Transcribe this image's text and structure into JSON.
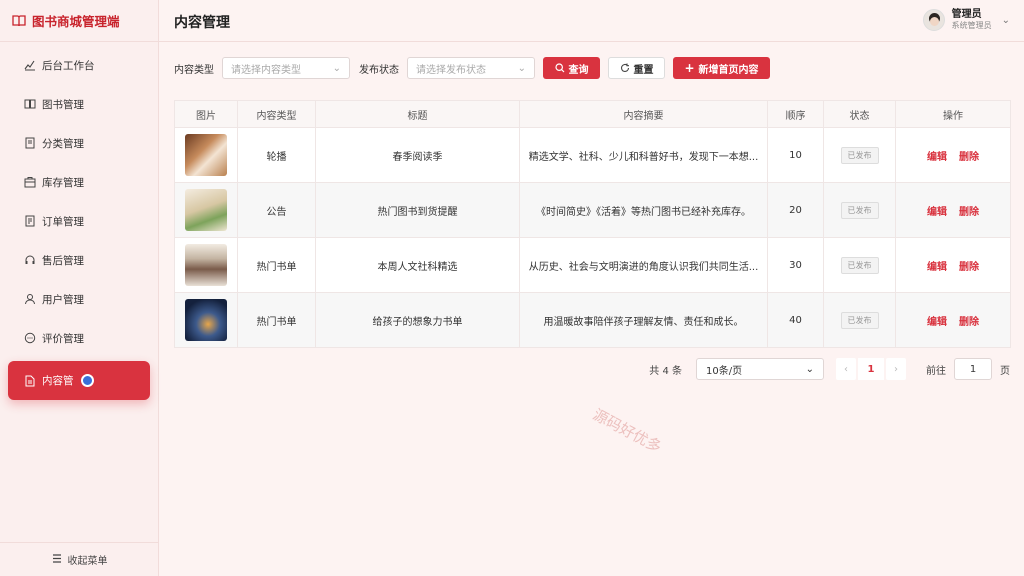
{
  "app": {
    "title": "图书商城管理端"
  },
  "sidebar": {
    "items": [
      {
        "label": "后台工作台",
        "icon": "dashboard-icon"
      },
      {
        "label": "图书管理",
        "icon": "book-icon"
      },
      {
        "label": "分类管理",
        "icon": "category-icon"
      },
      {
        "label": "库存管理",
        "icon": "inventory-icon"
      },
      {
        "label": "订单管理",
        "icon": "order-icon"
      },
      {
        "label": "售后管理",
        "icon": "headset-icon"
      },
      {
        "label": "用户管理",
        "icon": "user-icon"
      },
      {
        "label": "评价管理",
        "icon": "comment-icon"
      },
      {
        "label": "内容管",
        "icon": "document-icon",
        "active": true
      }
    ],
    "collapse_label": "收起菜单"
  },
  "header": {
    "title": "内容管理",
    "user_name": "管理员",
    "user_role": "系统管理员"
  },
  "filters": {
    "type_label": "内容类型",
    "type_placeholder": "请选择内容类型",
    "status_label": "发布状态",
    "status_placeholder": "请选择发布状态",
    "query_label": "查询",
    "reset_label": "重置",
    "add_label": "新增首页内容"
  },
  "table": {
    "columns": [
      "图片",
      "内容类型",
      "标题",
      "内容摘要",
      "顺序",
      "状态",
      "操作"
    ],
    "rows": [
      {
        "type": "轮播",
        "title": "春季阅读季",
        "summary": "精选文学、社科、少儿和科普好书，发现下一本想...",
        "order": "10",
        "status": "已发布",
        "edit": "编辑",
        "delete": "删除"
      },
      {
        "type": "公告",
        "title": "热门图书到货提醒",
        "summary": "《时间简史》《活着》等热门图书已经补充库存。",
        "order": "20",
        "status": "已发布",
        "edit": "编辑",
        "delete": "删除"
      },
      {
        "type": "热门书单",
        "title": "本周人文社科精选",
        "summary": "从历史、社会与文明演进的角度认识我们共同生活...",
        "order": "30",
        "status": "已发布",
        "edit": "编辑",
        "delete": "删除"
      },
      {
        "type": "热门书单",
        "title": "给孩子的想象力书单",
        "summary": "用温暖故事陪伴孩子理解友情、责任和成长。",
        "order": "40",
        "status": "已发布",
        "edit": "编辑",
        "delete": "删除"
      }
    ]
  },
  "pagination": {
    "total": "共 4 条",
    "page_size": "10条/页",
    "current_page": "1",
    "goto_label": "前往",
    "goto_value": "1",
    "page_suffix": "页"
  },
  "watermark": "源码好优多",
  "colors": {
    "accent": "#d9333f",
    "background": "#fdf3f2"
  }
}
